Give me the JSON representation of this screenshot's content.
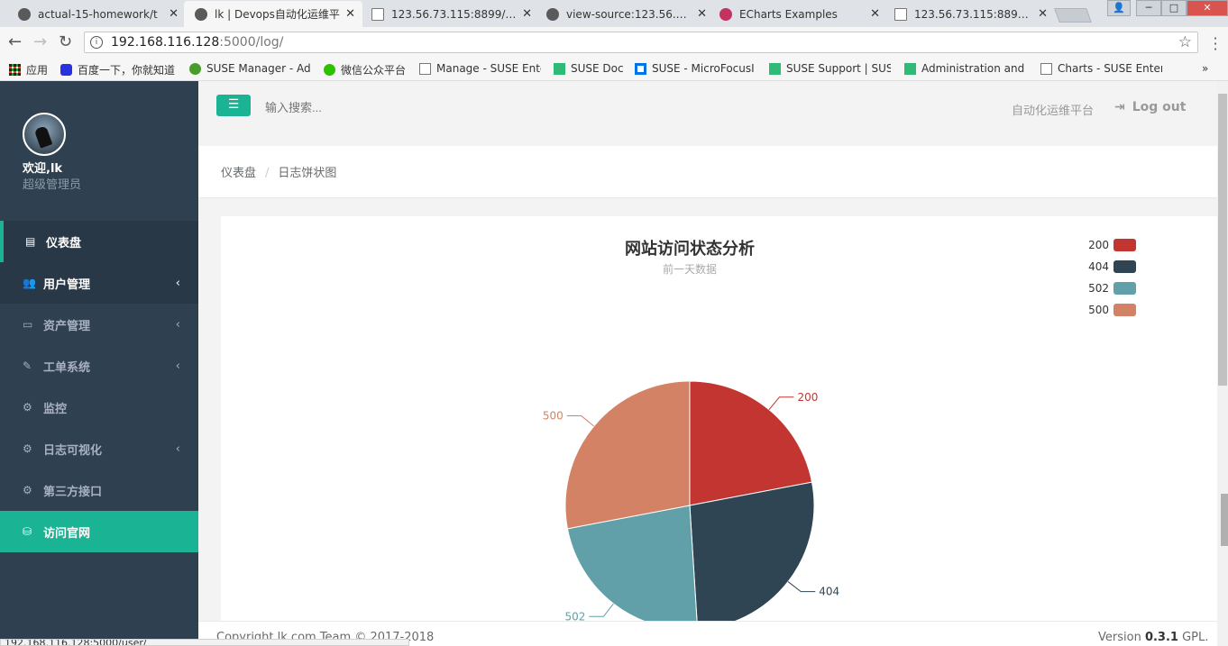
{
  "browser": {
    "tabs": [
      {
        "title": "actual-15-homework/t",
        "icon": "github-icon"
      },
      {
        "title": "lk | Devops自动化运维平",
        "icon": "site-icon"
      },
      {
        "title": "123.56.73.115:8899/ma",
        "icon": "doc-icon"
      },
      {
        "title": "view-source:123.56.73.",
        "icon": "site-icon"
      },
      {
        "title": "ECharts Examples",
        "icon": "echarts-icon"
      },
      {
        "title": "123.56.73.115:8899/sta",
        "icon": "doc-icon"
      }
    ],
    "url_host": "192.168.116.128",
    "url_path": ":5000/log/",
    "bookmarks": [
      "应用",
      "百度一下，你就知道",
      "SUSE Manager - Ad",
      "微信公众平台",
      "Manage - SUSE Ente",
      "SUSE Doc",
      "SUSE - MicroFocusI",
      "SUSE Support | SUS",
      "Administration and",
      "Charts - SUSE Enter"
    ],
    "status_url": "192.168.116.128:5000/user/"
  },
  "sidebar": {
    "welcome": "欢迎,lk",
    "role": "超级管理员",
    "items": [
      {
        "label": "仪表盘",
        "icon": "map-icon"
      },
      {
        "label": "用户管理",
        "icon": "users-icon"
      },
      {
        "label": "资产管理",
        "icon": "hdd-icon"
      },
      {
        "label": "工单系统",
        "icon": "edit-icon"
      },
      {
        "label": "监控",
        "icon": "cogs-icon"
      },
      {
        "label": "日志可视化",
        "icon": "cogs-icon"
      },
      {
        "label": "第三方接口",
        "icon": "cogs-icon"
      },
      {
        "label": "访问官网",
        "icon": "database-icon"
      }
    ]
  },
  "topnav": {
    "search_placeholder": "输入搜索...",
    "brand": "自动化运维平台",
    "logout": "Log out"
  },
  "breadcrumb": {
    "home": "仪表盘",
    "current": "日志饼状图"
  },
  "chart_data": {
    "type": "pie",
    "title": "网站访问状态分析",
    "subtitle": "前一天数据",
    "legend_position": "top-right",
    "categories": [
      "200",
      "404",
      "502",
      "500"
    ],
    "values": [
      22,
      27,
      23,
      28
    ],
    "colors": [
      "#c23531",
      "#2f4554",
      "#61a0a8",
      "#d48265"
    ]
  },
  "footer": {
    "copyright": "Copyright lk.com Team © 2017-2018",
    "version_prefix": "Version",
    "version": "0.3.1",
    "version_suffix": "GPL."
  }
}
